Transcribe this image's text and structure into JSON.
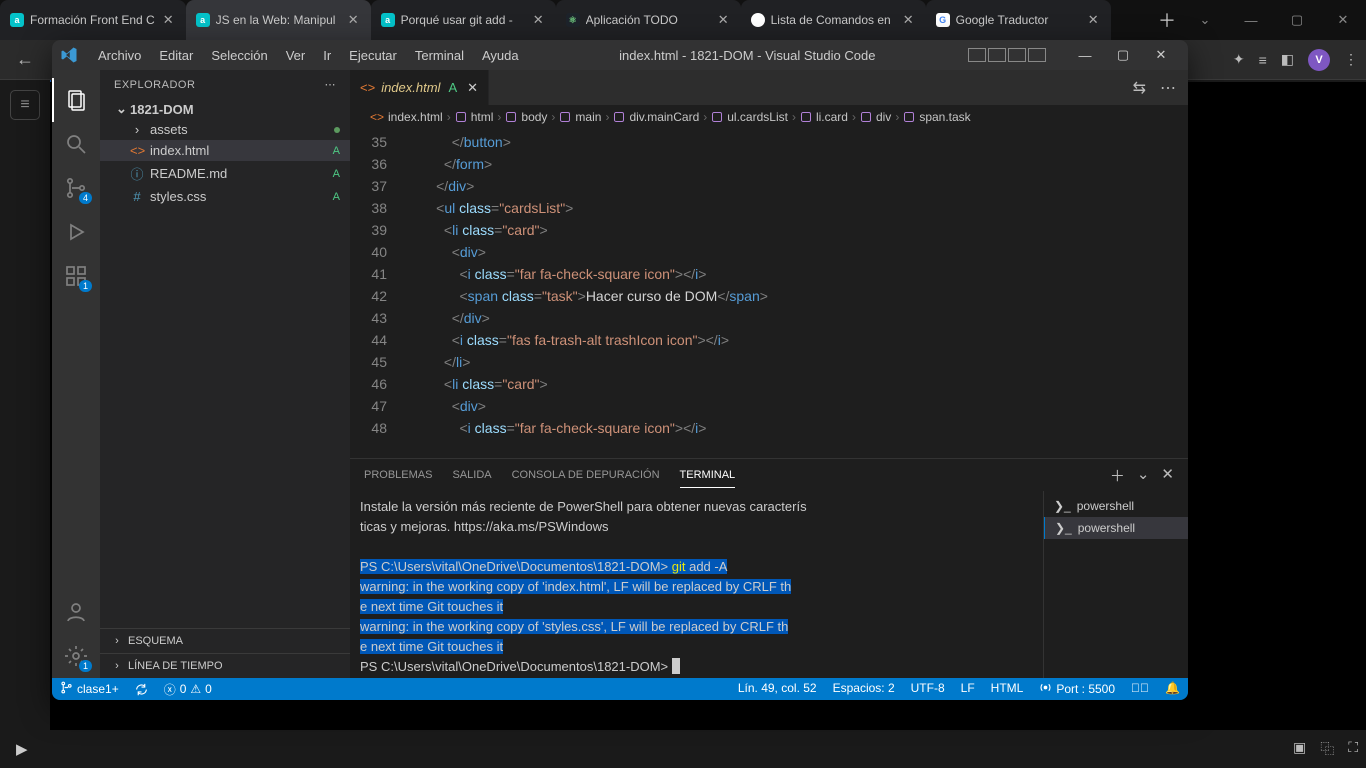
{
  "browser": {
    "tabs": [
      {
        "icon": "a",
        "cls": "",
        "title": "Formación Front End C"
      },
      {
        "icon": "a",
        "cls": "",
        "title": "JS en la Web: Manipul",
        "active": true
      },
      {
        "icon": "a",
        "cls": "",
        "title": "Porqué usar git add -"
      },
      {
        "icon": "⚛",
        "cls": "atom",
        "title": "Aplicación TODO"
      },
      {
        "icon": "",
        "cls": "gh",
        "title": "Lista de Comandos en"
      },
      {
        "icon": "G",
        "cls": "g",
        "title": "Google Traductor"
      }
    ],
    "avatar": "V"
  },
  "vscode": {
    "menu": [
      "Archivo",
      "Editar",
      "Selección",
      "Ver",
      "Ir",
      "Ejecutar",
      "Terminal",
      "Ayuda"
    ],
    "windowTitle": "index.html - 1821-DOM - Visual Studio Code",
    "activity": {
      "scmBadge": "4",
      "extBadge": "1",
      "gearBadge": "1"
    },
    "explorer": {
      "title": "EXPLORADOR",
      "root": "1821-DOM",
      "items": [
        {
          "name": "assets",
          "icon": "›",
          "type": "folder",
          "status": "dot"
        },
        {
          "name": "index.html",
          "icon": "<>",
          "iconColor": "#e37933",
          "status": "A",
          "sel": true
        },
        {
          "name": "README.md",
          "icon": "ⓘ",
          "iconColor": "#519aba",
          "status": "A"
        },
        {
          "name": "styles.css",
          "icon": "#",
          "iconColor": "#519aba",
          "status": "A"
        }
      ],
      "sections": [
        "ESQUEMA",
        "LÍNEA DE TIEMPO"
      ]
    },
    "tab": {
      "name": "index.html",
      "mod": "A"
    },
    "breadcrumbs": [
      "index.html",
      "html",
      "body",
      "main",
      "div.mainCard",
      "ul.cardsList",
      "li.card",
      "div",
      "span.task"
    ],
    "code": [
      {
        "n": 35,
        "html": "            <span class='t-pun'>&lt;/</span><span class='t-tag'>button</span><span class='t-pun'>&gt;</span>"
      },
      {
        "n": 36,
        "html": "          <span class='t-pun'>&lt;/</span><span class='t-tag'>form</span><span class='t-pun'>&gt;</span>"
      },
      {
        "n": 37,
        "html": "        <span class='t-pun'>&lt;/</span><span class='t-tag'>div</span><span class='t-pun'>&gt;</span>"
      },
      {
        "n": 38,
        "html": "        <span class='t-pun'>&lt;</span><span class='t-tag'>ul</span> <span class='t-attr'>class</span><span class='t-pun'>=</span><span class='t-str'>\"cardsList\"</span><span class='t-pun'>&gt;</span>"
      },
      {
        "n": 39,
        "html": "          <span class='t-pun'>&lt;</span><span class='t-tag'>li</span> <span class='t-attr'>class</span><span class='t-pun'>=</span><span class='t-str'>\"card\"</span><span class='t-pun'>&gt;</span>"
      },
      {
        "n": 40,
        "html": "            <span class='t-pun'>&lt;</span><span class='t-tag'>div</span><span class='t-pun'>&gt;</span>"
      },
      {
        "n": 41,
        "html": "              <span class='t-pun'>&lt;</span><span class='t-tag'>i</span> <span class='t-attr'>class</span><span class='t-pun'>=</span><span class='t-str'>\"far fa-check-square icon\"</span><span class='t-pun'>&gt;&lt;/</span><span class='t-tag'>i</span><span class='t-pun'>&gt;</span>"
      },
      {
        "n": 42,
        "html": "              <span class='t-pun'>&lt;</span><span class='t-tag'>span</span> <span class='t-attr'>class</span><span class='t-pun'>=</span><span class='t-str'>\"task\"</span><span class='t-pun'>&gt;</span><span class='t-txt'>Hacer curso de DOM</span><span class='t-pun'>&lt;/</span><span class='t-tag'>span</span><span class='t-pun'>&gt;</span>"
      },
      {
        "n": 43,
        "html": "            <span class='t-pun'>&lt;/</span><span class='t-tag'>div</span><span class='t-pun'>&gt;</span>"
      },
      {
        "n": 44,
        "html": "            <span class='t-pun'>&lt;</span><span class='t-tag'>i</span> <span class='t-attr'>class</span><span class='t-pun'>=</span><span class='t-str'>\"fas fa-trash-alt trashIcon icon\"</span><span class='t-pun'>&gt;&lt;/</span><span class='t-tag'>i</span><span class='t-pun'>&gt;</span>"
      },
      {
        "n": 45,
        "html": "          <span class='t-pun'>&lt;/</span><span class='t-tag'>li</span><span class='t-pun'>&gt;</span>"
      },
      {
        "n": 46,
        "html": "          <span class='t-pun'>&lt;</span><span class='t-tag'>li</span> <span class='t-attr'>class</span><span class='t-pun'>=</span><span class='t-str'>\"card\"</span><span class='t-pun'>&gt;</span>"
      },
      {
        "n": 47,
        "html": "            <span class='t-pun'>&lt;</span><span class='t-tag'>div</span><span class='t-pun'>&gt;</span>"
      },
      {
        "n": 48,
        "html": "              <span class='t-pun'>&lt;</span><span class='t-tag'>i</span> <span class='t-attr'>class</span><span class='t-pun'>=</span><span class='t-str'>\"far fa-check-square icon\"</span><span class='t-pun'>&gt;&lt;/</span><span class='t-tag'>i</span><span class='t-pun'>&gt;</span>"
      }
    ],
    "panel": {
      "tabs": [
        "PROBLEMAS",
        "SALIDA",
        "CONSOLA DE DEPURACIÓN",
        "TERMINAL"
      ],
      "active": 3,
      "shells": [
        "powershell",
        "powershell"
      ],
      "shellActive": 1,
      "termIntro1": "Instale la versión más reciente de PowerShell para obtener nuevas caracterís",
      "termIntro2": "ticas y mejoras. https://aka.ms/PSWindows",
      "prompt": "PS C:\\Users\\vital\\OneDrive\\Documentos\\1821-DOM>",
      "cmd": " git",
      "cmdArgs": " add -A",
      "warn1": "warning: in the working copy of 'index.html', LF will be replaced by CRLF th",
      "warn1b": "e next time Git touches it",
      "warn2": "warning: in the working copy of 'styles.css', LF will be replaced by CRLF th",
      "warn2b": "e next time Git touches it"
    },
    "status": {
      "branch": "clase1+",
      "errors": "0",
      "warnings": "0",
      "cursor": "Lín. 49, col. 52",
      "spaces": "Espacios: 2",
      "enc": "UTF-8",
      "eol": "LF",
      "lang": "HTML",
      "port": "Port : 5500"
    }
  }
}
